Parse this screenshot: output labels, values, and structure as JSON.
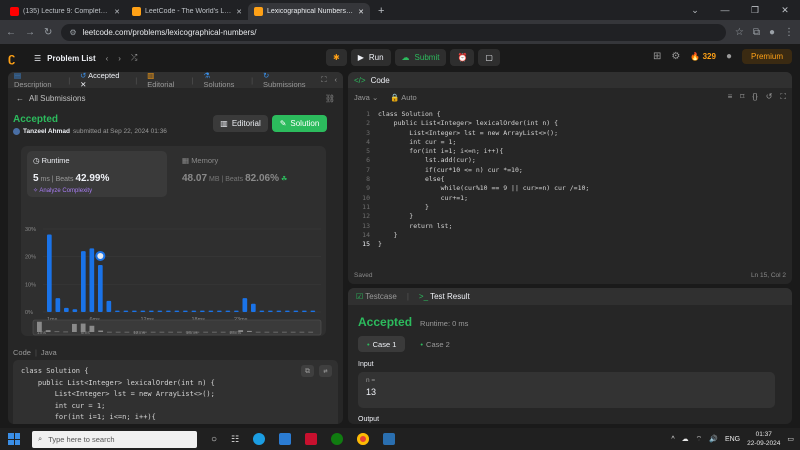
{
  "browser": {
    "tabs": [
      {
        "title": "(135) Lecture 9: Complete SQL",
        "color": "#ff0000"
      },
      {
        "title": "LeetCode - The World's Leading",
        "color": "#ffa116"
      },
      {
        "title": "Lexicographical Numbers - Lee",
        "color": "#ffa116"
      }
    ],
    "new_tab": "+",
    "url": "leetcode.com/problems/lexicographical-numbers/"
  },
  "header": {
    "problem_list": "Problem List",
    "run": "Run",
    "submit": "Submit",
    "streak": "329",
    "premium": "Premium"
  },
  "left": {
    "tabs": [
      "Description",
      "Accepted",
      "Editorial",
      "Solutions",
      "Submissions"
    ],
    "all_submissions": "All Submissions",
    "status": "Accepted",
    "author": "Tanzeel Ahmad",
    "submitted": "submitted at Sep 22, 2024 01:36",
    "editorial_btn": "Editorial",
    "solution_btn": "Solution",
    "runtime_label": "Runtime",
    "runtime_value": "5",
    "runtime_unit": "ms",
    "beats_label": "Beats",
    "runtime_beats": "42.99%",
    "analyze": "Analyze Complexity",
    "memory_label": "Memory",
    "memory_value": "48.07",
    "memory_unit": "MB",
    "memory_beats": "82.06%",
    "code_label": "Code",
    "code_lang": "Java",
    "code_preview": [
      "class Solution {",
      "    public List<Integer> lexicalOrder(int n) {",
      "        List<Integer> lst = new ArrayList<>();",
      "        int cur = 1;",
      "        for(int i=1; i<=n; i++){",
      "            lst.add(cur);"
    ]
  },
  "chart_data": {
    "type": "bar",
    "x_tick_labels": [
      "1ms",
      "6ms",
      "12ms",
      "18ms",
      "23ms"
    ],
    "y_tick_labels": [
      "30%",
      "20%",
      "10%",
      "0%"
    ],
    "ylim": [
      0,
      30
    ],
    "values": [
      28,
      5,
      1.5,
      1,
      22,
      23,
      17,
      4,
      0.5,
      0.5,
      0.5,
      0.5,
      0.5,
      0.5,
      0.5,
      0.5,
      0.5,
      0.5,
      0.5,
      0.5,
      0.5,
      0.5,
      0.5,
      5,
      3,
      0.5,
      0.5,
      0.5,
      0.5,
      0.5,
      0.5,
      0.5
    ],
    "highlight_index": 6,
    "mini_tick_labels": [
      "1ms",
      "6ms",
      "12ms",
      "18ms",
      "23ms"
    ]
  },
  "editor": {
    "title": "Code",
    "language": "Java",
    "mode": "Auto",
    "lines": [
      "class Solution {",
      "    public List<Integer> lexicalOrder(int n) {",
      "        List<Integer> lst = new ArrayList<>();",
      "        int cur = 1;",
      "        for(int i=1; i<=n; i++){",
      "            lst.add(cur);",
      "            if(cur*10 <= n) cur *=10;",
      "            else{",
      "                while(cur%10 == 9 || cur>=n) cur /=10;",
      "                cur+=1;",
      "            }",
      "        }",
      "        return lst;",
      "    }",
      "}"
    ],
    "saved": "Saved",
    "position": "Ln 15, Col 2"
  },
  "testpanel": {
    "testcase_tab": "Testcase",
    "result_tab": "Test Result",
    "status": "Accepted",
    "runtime": "Runtime: 0 ms",
    "cases": [
      "Case 1",
      "Case 2"
    ],
    "input_label": "Input",
    "var_name": "n =",
    "var_value": "13",
    "output_label": "Output"
  },
  "taskbar": {
    "search_placeholder": "Type here to search",
    "lang": "ENG",
    "time": "01:37",
    "date": "22-09-2024"
  }
}
